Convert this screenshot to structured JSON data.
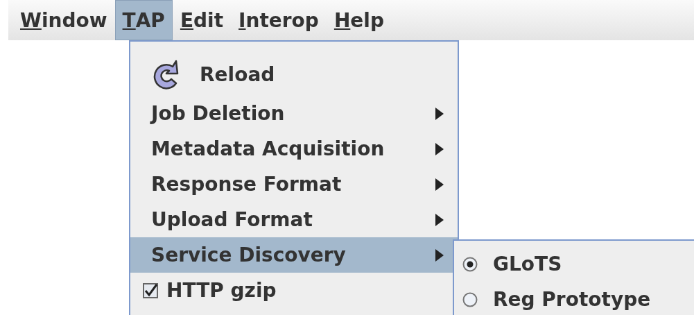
{
  "menu_bar": [
    {
      "mnemonic": "W",
      "rest": "indow",
      "selected": false
    },
    {
      "mnemonic": "T",
      "rest": "AP",
      "selected": true
    },
    {
      "mnemonic": "E",
      "rest": "dit",
      "selected": false
    },
    {
      "mnemonic": "I",
      "rest": "nterop",
      "selected": false
    },
    {
      "mnemonic": "H",
      "rest": "elp",
      "selected": false
    }
  ],
  "menu": {
    "items": [
      {
        "kind": "icon",
        "label": "Reload",
        "selected": false
      },
      {
        "kind": "submenu",
        "label": "Job Deletion",
        "selected": false
      },
      {
        "kind": "submenu",
        "label": "Metadata Acquisition",
        "selected": false
      },
      {
        "kind": "submenu",
        "label": "Response Format",
        "selected": false
      },
      {
        "kind": "submenu",
        "label": "Upload Format",
        "selected": false
      },
      {
        "kind": "submenu",
        "label": "Service Discovery",
        "selected": true
      },
      {
        "kind": "checkbox",
        "label": "HTTP gzip",
        "checked": true
      }
    ]
  },
  "submenu": {
    "items": [
      {
        "label": "GLoTS",
        "selected": true
      },
      {
        "label": "Reg Prototype",
        "selected": false
      }
    ]
  }
}
